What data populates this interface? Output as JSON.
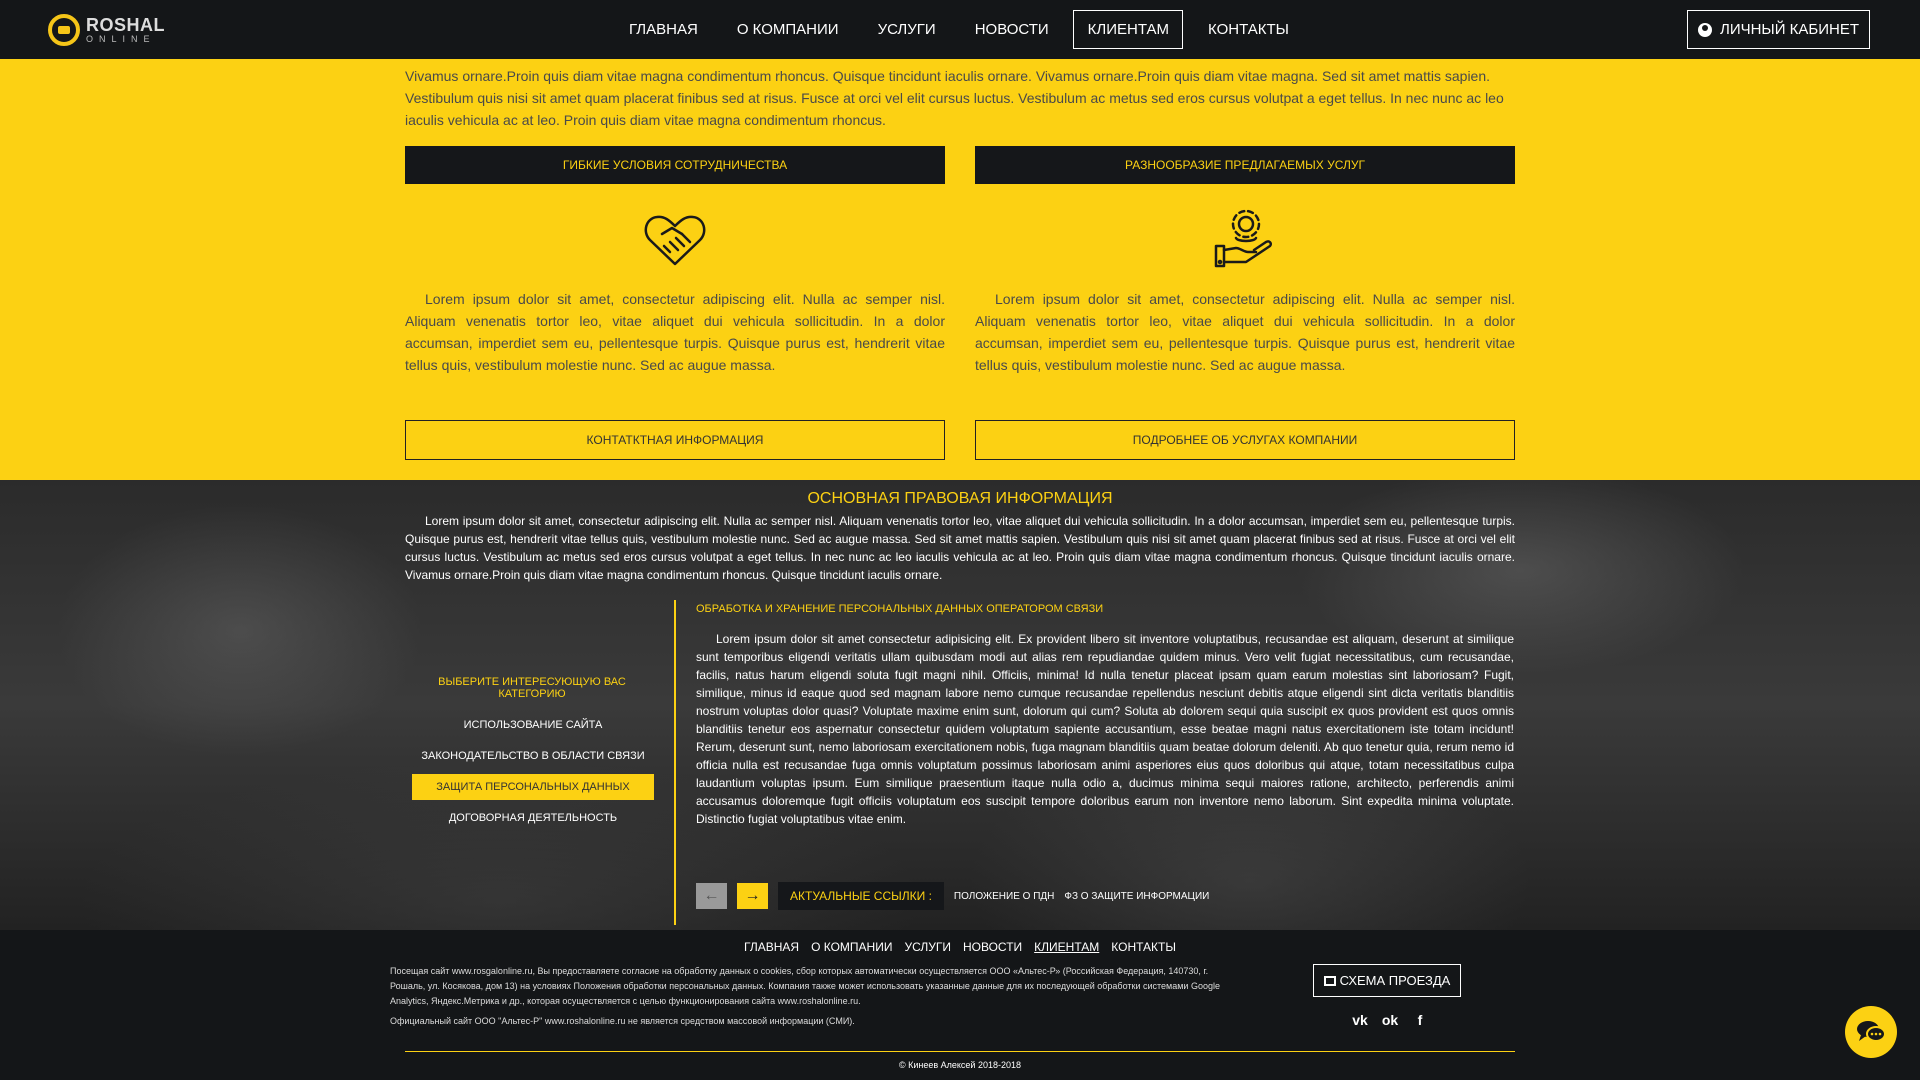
{
  "brand": {
    "title": "ROSHAL",
    "subtitle": "ONLINE"
  },
  "nav": {
    "items": [
      "ГЛАВНАЯ",
      "О КОМПАНИИ",
      "УСЛУГИ",
      "НОВОСТИ",
      "КЛИЕНТАМ",
      "КОНТАКТЫ"
    ],
    "active": "КЛИЕНТАМ"
  },
  "account_button": "ЛИЧНЫЙ КАБИНЕТ",
  "intro_text": "Vivamus ornare.Proin quis diam vitae magna condimentum rhoncus. Quisque tincidunt iaculis ornare. Vivamus ornare.Proin quis diam vitae magna. Sed sit amet mattis sapien. Vestibulum quis nisi sit amet quam placerat finibus sed at risus. Fusce at orci vel elit cursus luctus. Vestibulum ac metus sed eros cursus volutpat a eget tellus. In nec nunc ac leo iaculis vehicula ac at leo. Proin quis diam vitae magna condimentum rhoncus.",
  "features": [
    {
      "title": "ГИБКИЕ УСЛОВИЯ СОТРУДНИЧЕСТВА",
      "icon": "handshake-icon",
      "text": "Lorem ipsum dolor sit amet, consectetur adipiscing elit. Nulla ac semper nisl. Aliquam venenatis tortor leo, vitae aliquet dui vehicula sollicitudin. In a dolor accumsan, imperdiet sem eu, pellentesque turpis. Quisque purus est, hendrerit vitae tellus quis, vestibulum molestie nunc. Sed ac augue massa.",
      "button": "КОНТАТКТНАЯ ИНФОРМАЦИЯ"
    },
    {
      "title": "РАЗНООБРАЗИЕ ПРЕДЛАГАЕМЫХ УСЛУГ",
      "icon": "service-hand-icon",
      "text": "Lorem ipsum dolor sit amet, consectetur adipiscing elit. Nulla ac semper nisl. Aliquam venenatis tortor leo, vitae aliquet dui vehicula sollicitudin. In a dolor accumsan, imperdiet sem eu, pellentesque turpis. Quisque purus est, hendrerit vitae tellus quis, vestibulum molestie nunc. Sed ac augue massa.",
      "button": "ПОДРОБНЕЕ ОБ УСЛУГАХ КОМПАНИИ"
    }
  ],
  "legal": {
    "title": "ОСНОВНАЯ ПРАВОВАЯ ИНФОРМАЦИЯ",
    "intro": "Lorem ipsum dolor sit amet, consectetur adipiscing elit. Nulla ac semper nisl. Aliquam venenatis tortor leo, vitae aliquet dui vehicula sollicitudin. In a dolor accumsan, imperdiet sem eu, pellentesque turpis. Quisque purus est, hendrerit vitae tellus quis, vestibulum molestie nunc. Sed ac augue massa. Sed sit amet mattis sapien. Vestibulum quis nisi sit amet quam placerat finibus sed at risus. Fusce at orci vel elit cursus luctus. Vestibulum ac metus sed eros cursus volutpat a eget tellus. In nec nunc ac leo iaculis vehicula ac at leo. Proin quis diam vitae magna condimentum rhoncus. Quisque tincidunt iaculis ornare. Vivamus ornare.Proin quis diam vitae magna condimentum rhoncus. Quisque tincidunt iaculis ornare.",
    "category_prompt": "ВЫБЕРИТЕ ИНТЕРЕСУЮЩУЮ ВАС КАТЕГОРИЮ",
    "categories": [
      "ИСПОЛЬЗОВАНИЕ САЙТА",
      "ЗАКОНОДАТЕЛЬСТВО В ОБЛАСТИ СВЯЗИ",
      "ЗАЩИТА ПЕРСОНАЛЬНЫХ ДАННЫХ",
      "ДОГОВОРНАЯ ДЕЯТЕЛЬНОСТЬ"
    ],
    "active_category": "ЗАЩИТА ПЕРСОНАЛЬНЫХ ДАННЫХ",
    "article_title": "ОБРАБОТКА И ХРАНЕНИЕ ПЕРСОНАЛЬНЫХ ДАННЫХ ОПЕРАТОРОМ СВЯЗИ",
    "article_body": "Lorem ipsum dolor sit amet consectetur adipisicing elit. Ex provident libero sit inventore voluptatibus, recusandae est aliquam, deserunt at similique sunt temporibus eligendi veritatis ullam quibusdam modi aut alias rem repudiandae quidem minus. Vero velit fugiat necessitatibus, cum recusandae, facilis, natus harum eligendi soluta fugit magni nihil. Officiis, minima! Id nulla tenetur placeat ipsam quam earum molestias sint laboriosam? Fugit, similique, minus id eaque quod sed magnam labore nemo cumque recusandae repellendus nesciunt debitis atque eligendi sint dicta veritatis blanditiis nostrum voluptas dolor quasi? Voluptate maxime enim sunt, dolorum qui cum? Soluta ab dolorem sequi quia suscipit ex quos provident est quos omnis blanditiis tenetur eos aspernatur consectetur quidem voluptatum sapiente accusantium, esse beatae magni natus exercitationem iste totam incidunt! Rerum, deserunt sunt, nemo laboriosam exercitationem nobis, fuga magnam blanditiis quam beatae dolorum deleniti. Ab quo tenetur quia, rerum nemo id officia nulla est recusandae fuga omnis voluptatum possimus laboriosam animi asperiores eius quos doloribus qui atque, totam necessitatibus culpa laudantium voluptas ipsum. Eum similique praesentium itaque nulla odio a, ducimus minima sequi maiores ratione, architecto, perferendis animi accusamus doloremque fugit officiis voluptatum eos suscipit tempore doloribus earum non inventore nemo laborum. Sint expedita minima voluptate. Distinctio fugiat voluptatibus vitae enim.",
    "links_label": "АКТУАЛЬНЫЕ ССЫЛКИ :",
    "links": [
      "ПОЛОЖЕНИЕ О ПДН",
      "ФЗ О ЗАЩИТЕ ИНФОРМАЦИИ"
    ]
  },
  "footer": {
    "nav": [
      "ГЛАВНАЯ",
      "О КОМПАНИИ",
      "УСЛУГИ",
      "НОВОСТИ",
      "КЛИЕНТАМ",
      "КОНТАКТЫ"
    ],
    "active": "КЛИЕНТАМ",
    "note_1": "Посещая сайт www.rosgalonline.ru, Вы предоставляете согласие на обработку данных о cookies, сбор которых автоматически осуществляется ООО «Альтес-Р» (Российская Федерация, 140730, г. Рошаль, ул. Косякова, дом 13) на условиях Положения обработки персональных данных. Компания также может использовать указанные данные для их последующей обработки системами Google Analytics, Яндекс.Метрика и др., которая осуществляется с целью функционирования сайта www.roshalonline.ru.",
    "note_2": "Официальный сайт ООО \"Альтес-Р\" www.roshalonline.ru не является средством массовой информации (СМИ).",
    "route_button": "СХЕМА ПРОЕЗДА",
    "socials": [
      "vk-icon",
      "odnoklassniki-icon",
      "facebook-icon"
    ],
    "social_glyphs": [
      "vk",
      "ok",
      "f"
    ],
    "copyright": "© Кинеев Алексей 2018-2018"
  },
  "colors": {
    "accent": "#fcd113",
    "dark": "#15171a"
  }
}
